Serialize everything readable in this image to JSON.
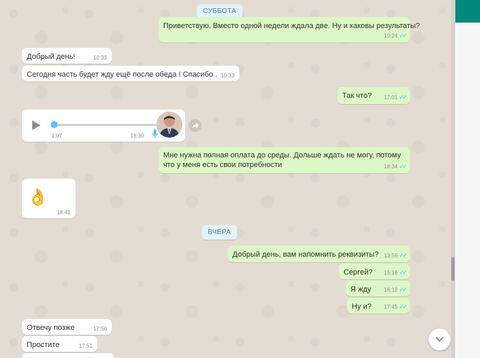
{
  "dates": {
    "saturday": "СУББОТА",
    "yesterday": "ВЧЕРА"
  },
  "messages": {
    "m1": {
      "text": "Приветствую. Вместо одной недели ждала две. Ну и каковы результаты?",
      "time": "10:24"
    },
    "m2": {
      "text": "Добрый день!",
      "time": "10:33"
    },
    "m3": {
      "text": "Сегодня часть будет жду ещё после обеда ! Спасибо .",
      "time": "10:33"
    },
    "m4": {
      "text": "Так что?",
      "time": "17:01"
    },
    "voice": {
      "duration": "1:07",
      "time": "18:30",
      "progress": 0
    },
    "m5": {
      "text": "Мне нужна полная оплата до среды. Дольше ждать не могу, потому что у меня есть свои потребности",
      "time": "18:34"
    },
    "m6": {
      "emoji": "👌",
      "time": "18:41"
    },
    "m7": {
      "text": "Добрый день, вам напомнить реквизиты?",
      "time": "13:56"
    },
    "m8": {
      "text": "Сергей?",
      "time": "15:16"
    },
    "m9": {
      "text": "Я жду",
      "time": "16:12"
    },
    "m10": {
      "text": "Ну и?",
      "time": "17:45"
    },
    "m11": {
      "text": "Отвечу позже",
      "time": "17:50"
    },
    "m12": {
      "text": "Простите",
      "time": "17:51"
    }
  },
  "colors": {
    "outgoing": "#dcf8c6",
    "incoming": "#ffffff",
    "read_ticks": "#4fc3f7",
    "header": "#00897b"
  }
}
